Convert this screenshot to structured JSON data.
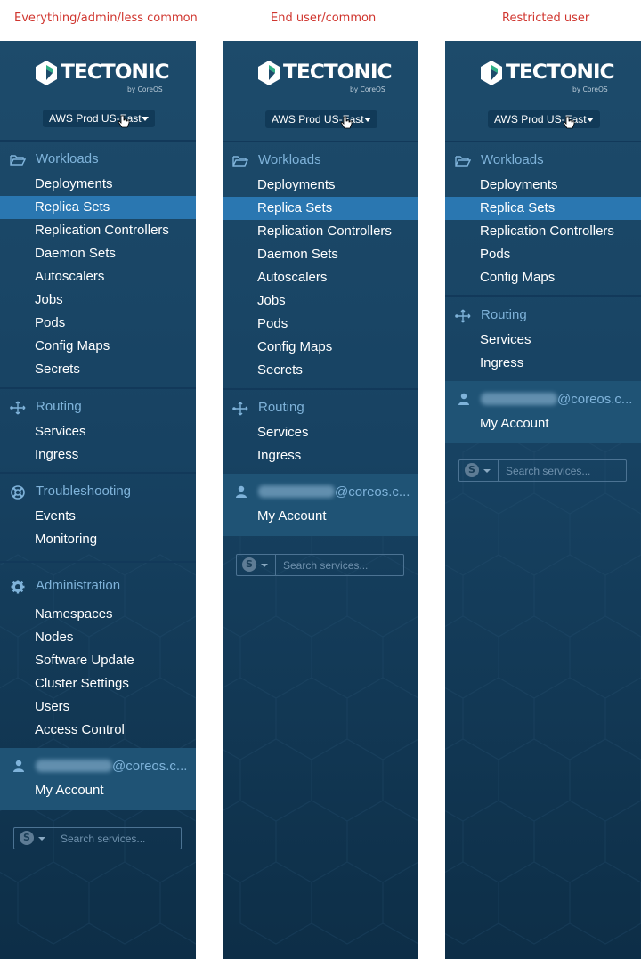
{
  "columns": [
    {
      "title": "Everything/admin/less common"
    },
    {
      "title": "End user/common"
    },
    {
      "title": "Restricted user"
    }
  ],
  "brand": {
    "name": "TECTONIC",
    "byline": "by CoreOS"
  },
  "cluster": {
    "label": "AWS Prod US-East"
  },
  "sections": {
    "workloads": "Workloads",
    "routing": "Routing",
    "troubleshooting": "Troubleshooting",
    "administration": "Administration"
  },
  "items": {
    "deployments": "Deployments",
    "replica_sets": "Replica Sets",
    "replication_controllers": "Replication Controllers",
    "daemon_sets": "Daemon Sets",
    "autoscalers": "Autoscalers",
    "jobs": "Jobs",
    "pods": "Pods",
    "config_maps": "Config Maps",
    "secrets": "Secrets",
    "services": "Services",
    "ingress": "Ingress",
    "events": "Events",
    "monitoring": "Monitoring",
    "namespaces": "Namespaces",
    "nodes": "Nodes",
    "software_update": "Software Update",
    "cluster_settings": "Cluster Settings",
    "users": "Users",
    "access_control": "Access Control"
  },
  "user": {
    "email_domain": "@coreos.c...",
    "account": "My Account"
  },
  "search": {
    "placeholder": "Search services...",
    "badge": "S"
  },
  "colors": {
    "column_title": "#d0362f",
    "sidebar": "#1d4b6b",
    "active_item": "#2a77b1",
    "section_label": "#7fb3da"
  }
}
